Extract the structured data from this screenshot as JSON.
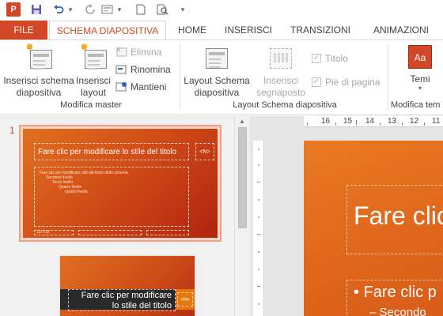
{
  "qat": {
    "app_icon_text": "P",
    "save_icon": "save-icon",
    "undo_icon": "undo-icon",
    "redo_icon": "redo-icon",
    "customize_icon": "customize-qat-icon"
  },
  "tabs": [
    {
      "label": "FILE"
    },
    {
      "label": "SCHEMA DIAPOSITIVA"
    },
    {
      "label": "HOME"
    },
    {
      "label": "INSERISCI"
    },
    {
      "label": "TRANSIZIONI"
    },
    {
      "label": "ANIMAZIONI"
    }
  ],
  "ribbon": {
    "insert_master": "Inserisci schema\ndiapositiva",
    "insert_layout": "Inserisci\nlayout",
    "delete": "Elimina",
    "rename": "Rinomina",
    "preserve": "Mantieni",
    "group_edit_master": "Modifica master",
    "master_layout": "Layout Schema\ndiapositiva",
    "insert_placeholder": "Inserisci\nsegnaposto",
    "title_check": "Titolo",
    "footer_check": "Piè di pagina",
    "group_master_layout": "Layout Schema diapositiva",
    "themes": "Temi",
    "themes_icon_text": "Aa",
    "group_edit_theme": "Modifica tem",
    "colors": {
      "accent": "#d24726",
      "disabled": "#a7a7a7"
    }
  },
  "thumbs": {
    "number": "1",
    "master": {
      "title": "Fare clic per modificare lo stile del titolo",
      "num": "<N>",
      "body_lines": [
        "Fare clic per modificare stili del testo dello schema",
        "Secondo livello",
        "Terzo livello",
        "Quarto livello",
        "Quinto livello"
      ],
      "footer_left": "12/7/18"
    },
    "layout": {
      "title": "Fare clic per modificare\nlo stile del titolo",
      "num": "<N>"
    }
  },
  "ruler": {
    "labels": [
      "16",
      "15",
      "14",
      "13",
      "12",
      "11"
    ]
  },
  "canvas": {
    "title": "Fare clic p",
    "body1": "Fare clic p",
    "body2": "Secondo"
  }
}
